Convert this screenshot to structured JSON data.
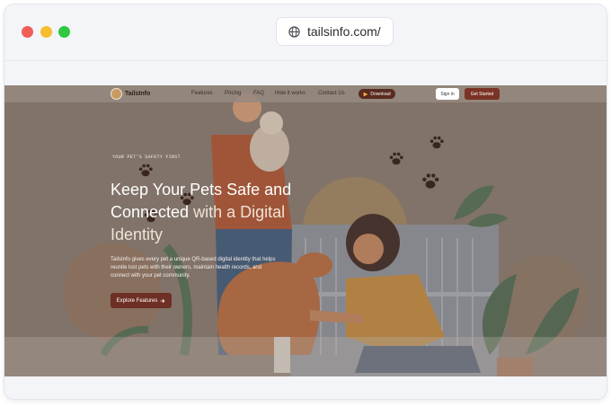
{
  "browser": {
    "url": "tailsinfo.com/",
    "traffic_lights": {
      "close": "#ef5f58",
      "minimize": "#f6be2f",
      "maximize": "#2fc840"
    }
  },
  "site": {
    "logo_text": "TailsInfo",
    "nav_links": [
      "Features",
      "Pricing",
      "FAQ",
      "How it works",
      "Contact Us"
    ],
    "download_label": "Download",
    "signin_label": "Sign in",
    "get_started_label": "Get Started",
    "hero": {
      "tagline": "YOUR PET'S SAFETY FIRST",
      "title_main": "Keep Your Pets Safe and Connected",
      "title_accent": " with a Digital Identity",
      "description": "TailsInfo gives every pet a unique QR-based digital identity that helps reunite lost pets with their owners, maintain health records, and connect with your pet community.",
      "cta_label": "Explore Features",
      "cta_icon": "arrow-right-icon"
    },
    "colors": {
      "brand": "#7a3326",
      "overlay": "#8c7d73"
    }
  }
}
